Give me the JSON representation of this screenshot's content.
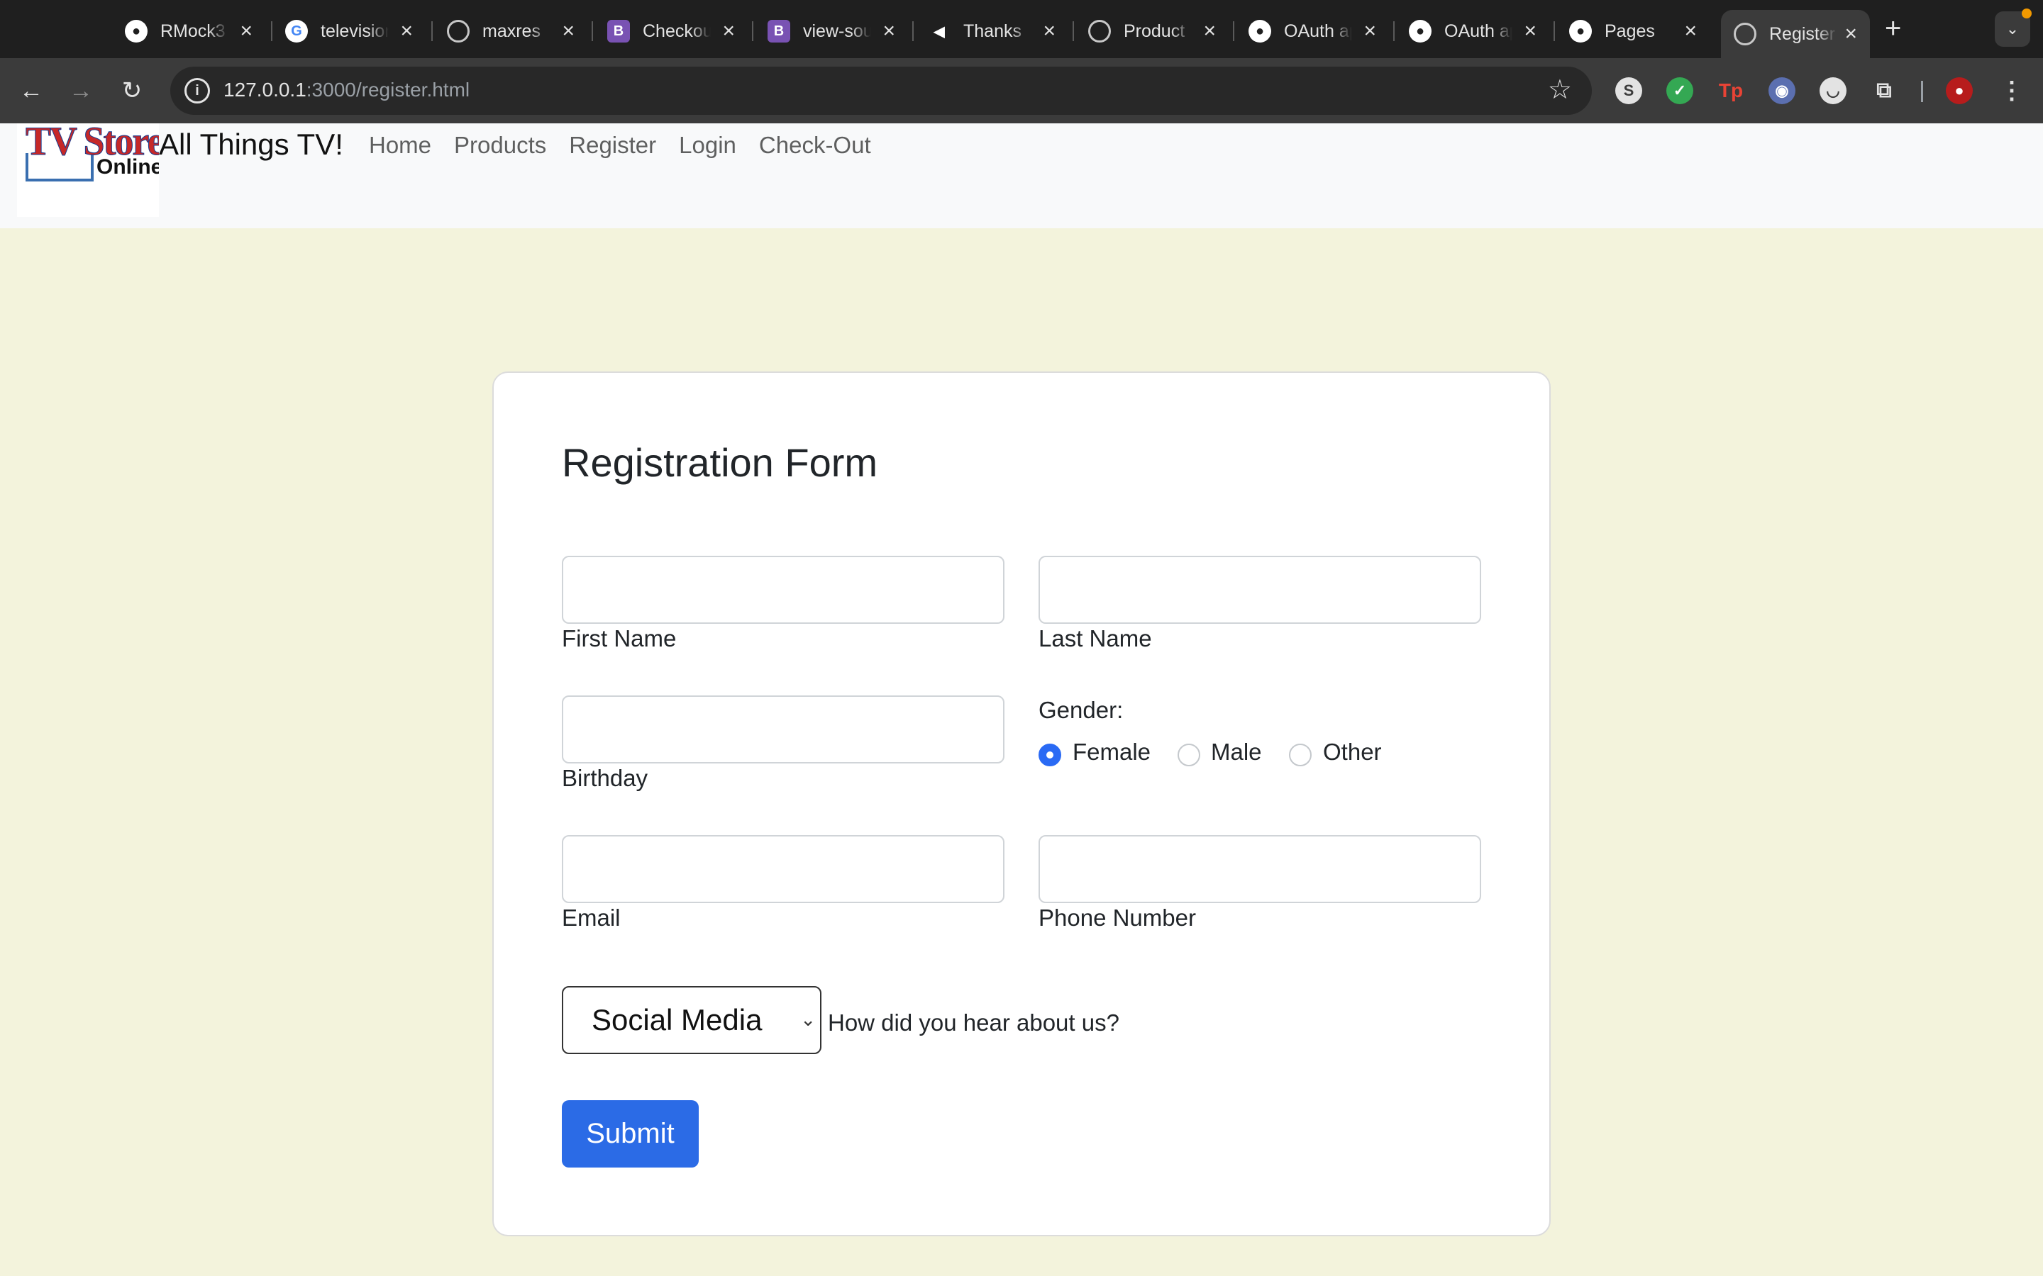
{
  "browser": {
    "tabs": [
      {
        "title": "RMock3",
        "icon": "github-icon"
      },
      {
        "title": "television",
        "icon": "google-icon"
      },
      {
        "title": "maxres",
        "icon": "globe-icon"
      },
      {
        "title": "Checkout",
        "icon": "bootstrap-icon"
      },
      {
        "title": "view-source",
        "icon": "bootstrap-icon"
      },
      {
        "title": "Thanks",
        "icon": "vercel-icon"
      },
      {
        "title": "Product",
        "icon": "globe-icon"
      },
      {
        "title": "OAuth app",
        "icon": "github-icon"
      },
      {
        "title": "OAuth app",
        "icon": "github-icon"
      },
      {
        "title": "Pages",
        "icon": "github-icon"
      },
      {
        "title": "Register",
        "icon": "globe-icon",
        "active": true
      }
    ],
    "url_host": "127.0.0.1",
    "url_path": ":3000/register.html"
  },
  "site": {
    "logo_line1": "TV Store",
    "logo_line2": "Online",
    "brand": "All Things TV!",
    "nav": [
      "Home",
      "Products",
      "Register",
      "Login",
      "Check-Out"
    ]
  },
  "form": {
    "title": "Registration Form",
    "first_name_label": "First Name",
    "last_name_label": "Last Name",
    "birthday_label": "Birthday",
    "gender_label": "Gender:",
    "gender_options": [
      "Female",
      "Male",
      "Other"
    ],
    "gender_selected": "Female",
    "email_label": "Email",
    "phone_label": "Phone Number",
    "referral_value": "Social Media",
    "referral_help": "How did you hear about us?",
    "submit_label": "Submit"
  },
  "colors": {
    "page_bg": "#f3f3dc",
    "accent": "#2b6be6"
  }
}
